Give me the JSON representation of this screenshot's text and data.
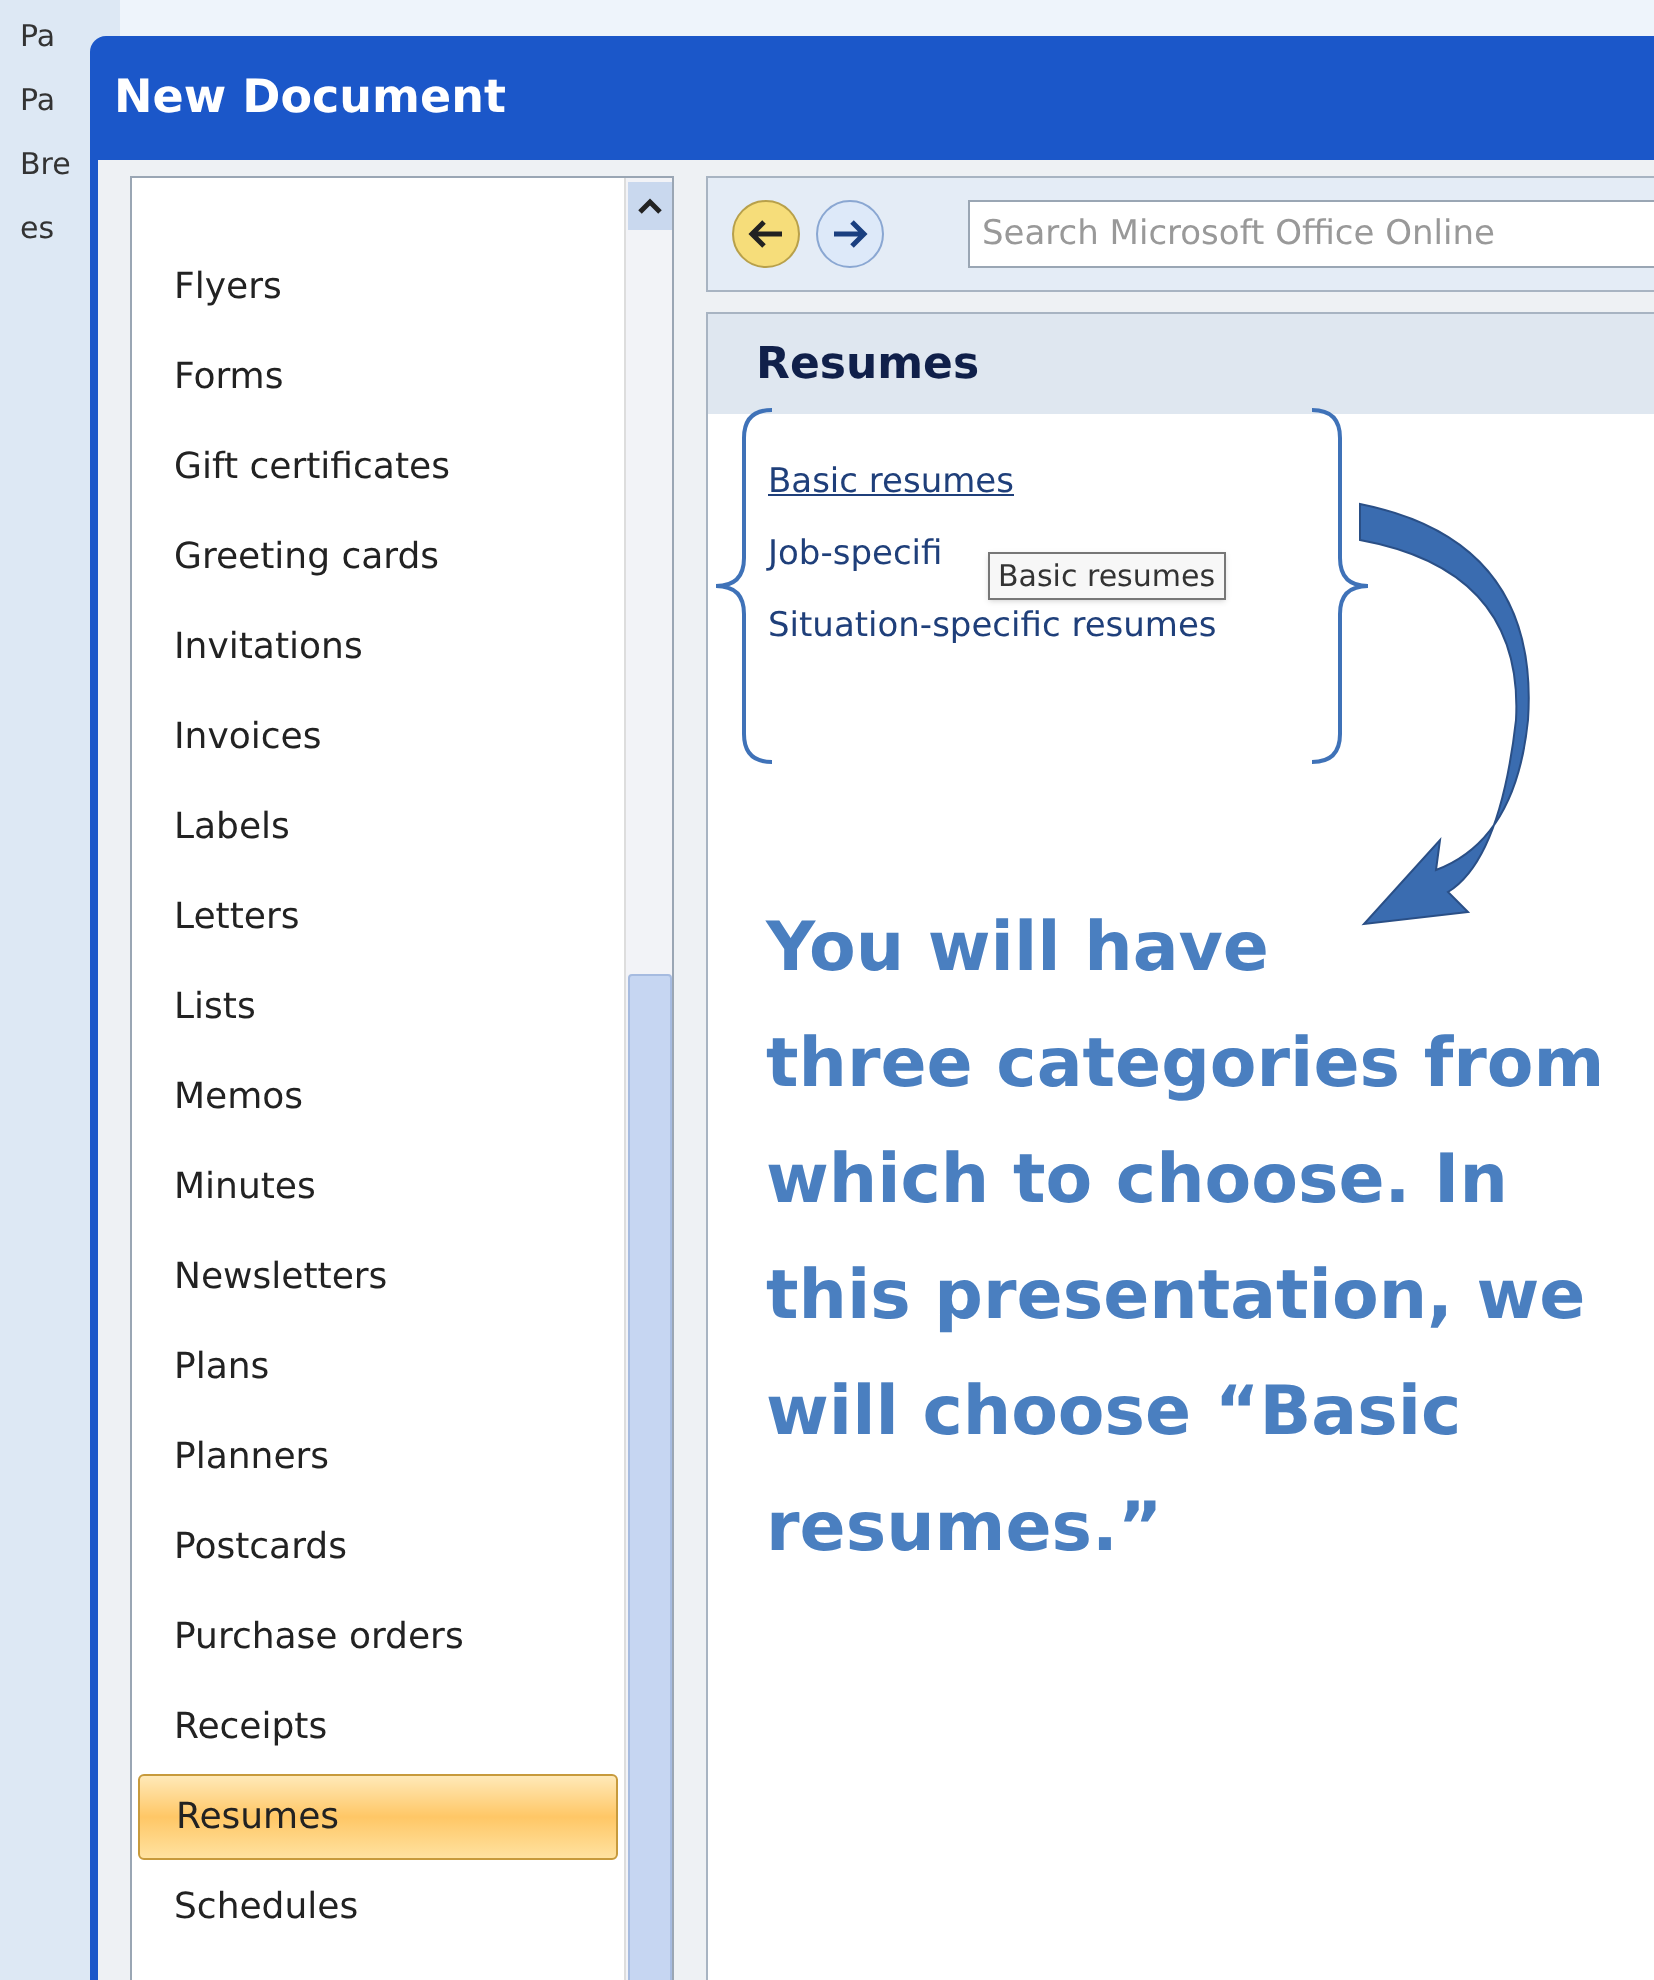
{
  "background_ribbon": [
    "Pa",
    "Pa",
    "Bre",
    "es"
  ],
  "window": {
    "title": "New Document"
  },
  "categories": [
    {
      "label": "Flyers",
      "selected": false
    },
    {
      "label": "Forms",
      "selected": false
    },
    {
      "label": "Gift certificates",
      "selected": false
    },
    {
      "label": "Greeting cards",
      "selected": false
    },
    {
      "label": "Invitations",
      "selected": false
    },
    {
      "label": "Invoices",
      "selected": false
    },
    {
      "label": "Labels",
      "selected": false
    },
    {
      "label": "Letters",
      "selected": false
    },
    {
      "label": "Lists",
      "selected": false
    },
    {
      "label": "Memos",
      "selected": false
    },
    {
      "label": "Minutes",
      "selected": false
    },
    {
      "label": "Newsletters",
      "selected": false
    },
    {
      "label": "Plans",
      "selected": false
    },
    {
      "label": "Planners",
      "selected": false
    },
    {
      "label": "Postcards",
      "selected": false
    },
    {
      "label": "Purchase orders",
      "selected": false
    },
    {
      "label": "Receipts",
      "selected": false
    },
    {
      "label": "Resumes",
      "selected": true
    },
    {
      "label": "Schedules",
      "selected": false
    }
  ],
  "search": {
    "placeholder": "Search Microsoft Office Online"
  },
  "section": {
    "title": "Resumes",
    "links": [
      {
        "label": "Basic resumes",
        "kind": "link"
      },
      {
        "label": "Job-specifi",
        "kind": "plain"
      },
      {
        "label": "Situation-specific resumes",
        "kind": "plain"
      }
    ]
  },
  "tooltip": "Basic resumes",
  "annotation": [
    "You will have",
    "three categories from",
    "which to choose.  In",
    "this presentation, we",
    "will choose “Basic",
    "resumes.”"
  ]
}
